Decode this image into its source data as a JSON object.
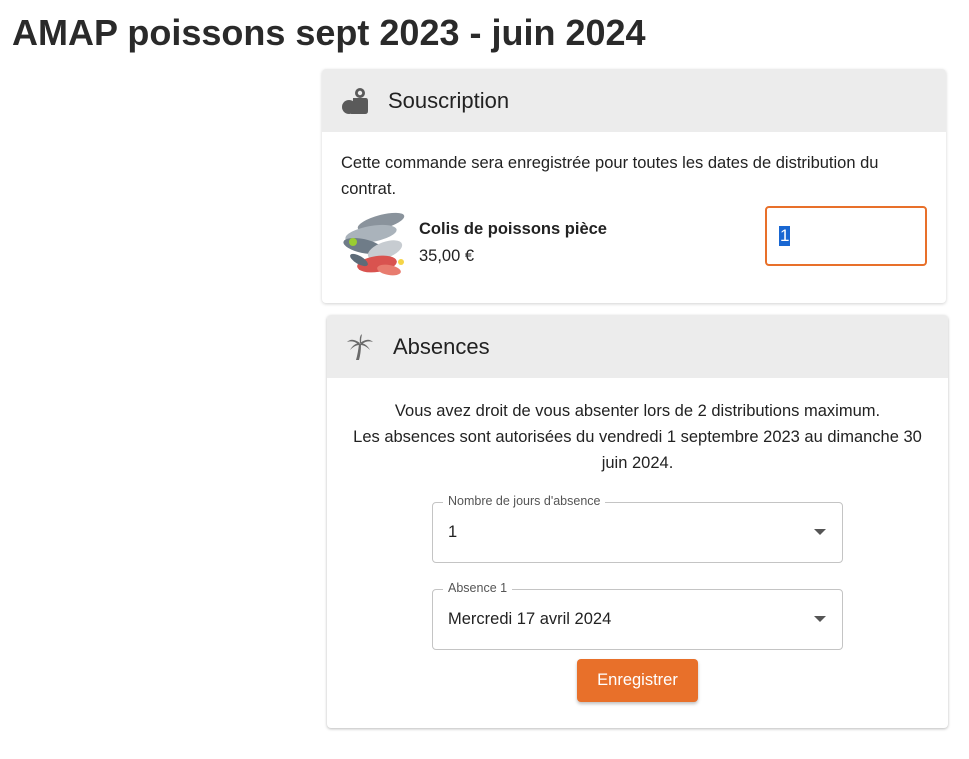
{
  "page": {
    "title": "AMAP poissons sept 2023 - juin 2024"
  },
  "souscription": {
    "title": "Souscription",
    "icon": "weight-icon",
    "description": "Cette commande sera enregistrée pour toutes les dates de distribution du contrat.",
    "product": {
      "name": "Colis de poissons pièce",
      "price": "35,00 €",
      "image": "fish-assortment-photo",
      "quantity": "1"
    }
  },
  "absences": {
    "title": "Absences",
    "icon": "palm-tree-icon",
    "line1": "Vous avez droit de vous absenter lors de 2 distributions maximum.",
    "line2": "Les absences sont autorisées du vendredi 1 septembre 2023 au dimanche 30 juin 2024.",
    "jours_field": {
      "label": "Nombre de jours d'absence",
      "value": "1"
    },
    "absence1_field": {
      "label": "Absence 1",
      "value": "Mercredi 17 avril 2024"
    },
    "save_label": "Enregistrer"
  },
  "colors": {
    "accent": "#e8702a",
    "header_bg": "#ececec",
    "selection": "#1967d2"
  }
}
